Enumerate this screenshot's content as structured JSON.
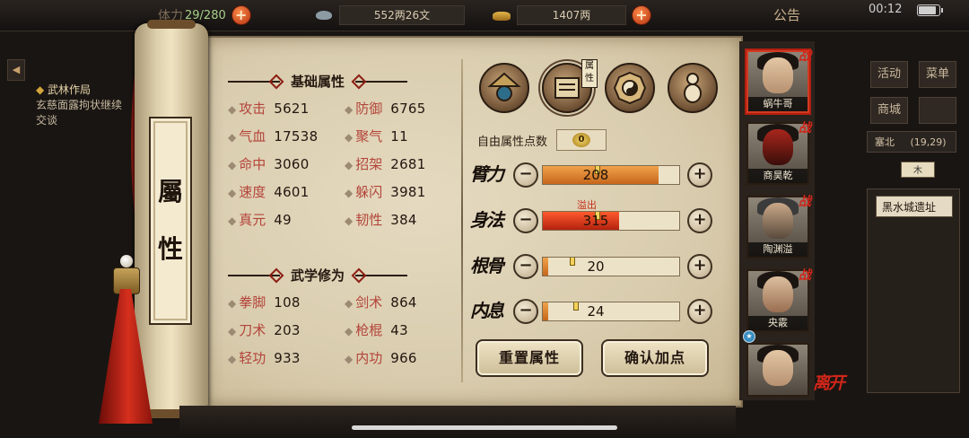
{
  "topbar": {
    "stamina_label": "体力",
    "stamina_value": "29/280",
    "silver_value": "552两26文",
    "gold_value": "1407两",
    "plus": "+",
    "notice": "公告",
    "clock": "00:12"
  },
  "quest": {
    "title": "武林作局",
    "desc": "玄慈面露拘状继续交谈",
    "arrow": "◀"
  },
  "scroll_title": [
    "屬",
    "性"
  ],
  "basic": {
    "heading": "基础属性",
    "stats": [
      {
        "name": "攻击",
        "value": "5621"
      },
      {
        "name": "防御",
        "value": "6765"
      },
      {
        "name": "气血",
        "value": "17538"
      },
      {
        "name": "聚气",
        "value": "11"
      },
      {
        "name": "命中",
        "value": "3060"
      },
      {
        "name": "招架",
        "value": "2681"
      },
      {
        "name": "速度",
        "value": "4601"
      },
      {
        "name": "躲闪",
        "value": "3981"
      },
      {
        "name": "真元",
        "value": "49"
      },
      {
        "name": "韧性",
        "value": "384"
      }
    ]
  },
  "martial": {
    "heading": "武学修为",
    "stats": [
      {
        "name": "拳脚",
        "value": "108"
      },
      {
        "name": "剑术",
        "value": "864"
      },
      {
        "name": "刀术",
        "value": "203"
      },
      {
        "name": "枪棍",
        "value": "43"
      },
      {
        "name": "轻功",
        "value": "933"
      },
      {
        "name": "内功",
        "value": "966"
      }
    ]
  },
  "tabs": {
    "attr_tag": "属性"
  },
  "free_points": {
    "label": "自由属性点数",
    "value": "0"
  },
  "allocation": {
    "minus": "−",
    "plus": "+",
    "overflow_label": "溢出",
    "rows": [
      {
        "label": "臂力",
        "value": "208",
        "fill_fraction": 0.85,
        "overflow": false
      },
      {
        "label": "身法",
        "value": "315",
        "fill_fraction": 0.56,
        "overflow": true
      },
      {
        "label": "根骨",
        "value": "20",
        "fill_fraction": 0.04,
        "overflow": false
      },
      {
        "label": "内息",
        "value": "24",
        "fill_fraction": 0.04,
        "overflow": false
      }
    ]
  },
  "buttons": {
    "reset": "重置属性",
    "confirm": "确认加点"
  },
  "party": [
    {
      "name": "蜗牛哥",
      "active": true
    },
    {
      "name": "商昊乾",
      "active": false
    },
    {
      "name": "陶渊溢",
      "active": false
    },
    {
      "name": "央霰",
      "active": false
    },
    {
      "name": "",
      "active": false
    }
  ],
  "war_mark": "战",
  "leave": "离开",
  "sidebar": {
    "activity": "活动",
    "menu": "菜单",
    "shop": "商城",
    "region": "塞北",
    "region_time": "(19,29)",
    "compass": "木",
    "place": "黑水城遗址"
  }
}
